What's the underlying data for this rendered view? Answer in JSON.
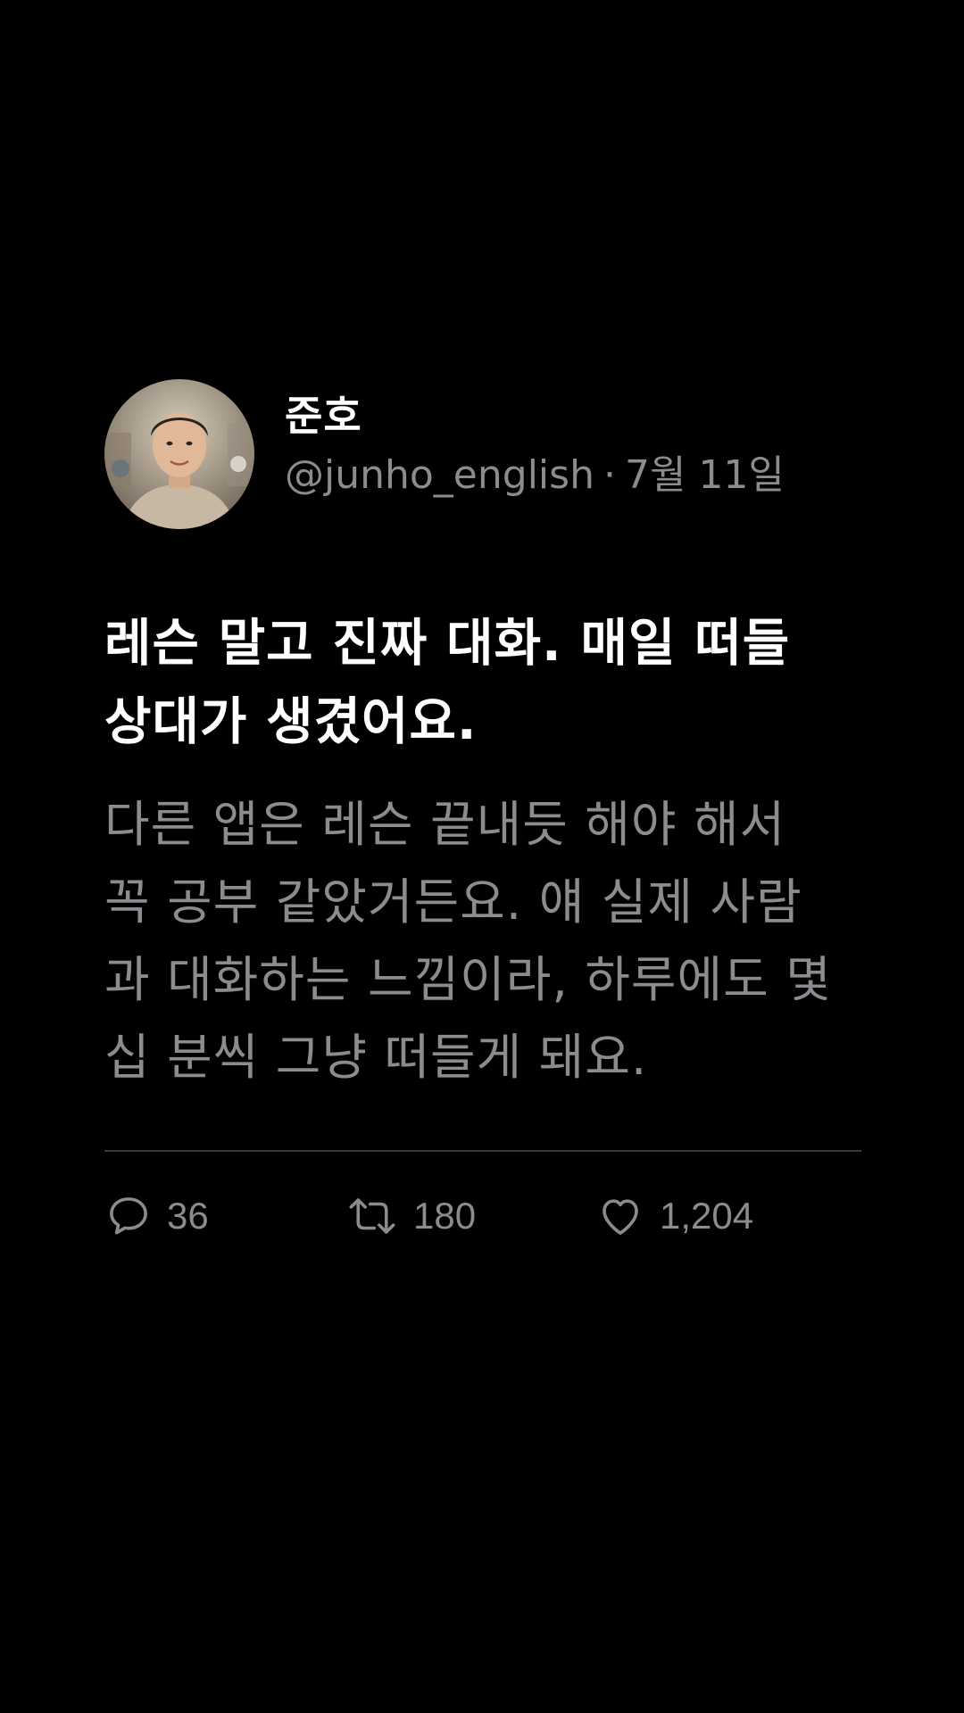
{
  "tweet": {
    "author": {
      "display_name": "준호",
      "handle": "@junho_english",
      "separator": "·",
      "date": "7월 11일",
      "avatar": "profile-photo"
    },
    "headline": "레슨 말고 진짜 대화. 매일 떠들 상대가 생겼어요.",
    "body": "다른 앱은 레슨 끝내듯 해야 해서 꼭 공부 같았거든요. 얘 실제 사람과 대화하는 느낌이라, 하루에도 몇십 분씩 그냥 떠들게 돼요.",
    "actions": {
      "reply": {
        "icon": "reply-icon",
        "count": "36"
      },
      "retweet": {
        "icon": "retweet-icon",
        "count": "180"
      },
      "like": {
        "icon": "heart-icon",
        "count": "1,204"
      }
    }
  },
  "colors": {
    "background": "#000000",
    "primary_text": "#ffffff",
    "secondary_text": "#8b8b90",
    "divider": "#3a3a3e"
  }
}
